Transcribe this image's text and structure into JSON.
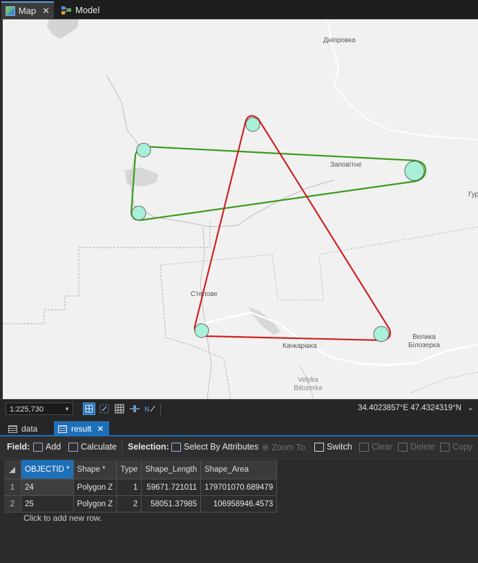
{
  "tabs": [
    {
      "label": "Map"
    },
    {
      "label": "Model"
    }
  ],
  "map": {
    "places": {
      "dniprovka": "Дніпровка",
      "zapovitne": "Заповітне",
      "hur": "Гур",
      "stepove": "Степове",
      "kachkarivka": "Качкарівка",
      "velyka_bilozerka_ua_1": "Велика",
      "velyka_bilozerka_ua_2": "Білозерка",
      "velyka_bilozerka_en_1": "Velyka",
      "velyka_bilozerka_en_2": "Bilozerka"
    },
    "colors": {
      "green_polygon": "#3a9a1a",
      "red_polygon": "#d01f1f",
      "vertex_fill": "#a8f0d8"
    }
  },
  "status": {
    "scale": "1:225,730",
    "coordinates": "34.4023857°E 47.4324319°N"
  },
  "table_tabs": [
    {
      "label": "data"
    },
    {
      "label": "result"
    }
  ],
  "toolbar": {
    "field_label": "Field:",
    "add": "Add",
    "calculate": "Calculate",
    "selection_label": "Selection:",
    "select_by_attributes": "Select By Attributes",
    "zoom_to": "Zoom To",
    "switch": "Switch",
    "clear": "Clear",
    "delete": "Delete",
    "copy": "Copy"
  },
  "table": {
    "columns": [
      "OBJECTID *",
      "Shape *",
      "Type",
      "Shape_Length",
      "Shape_Area"
    ],
    "rows": [
      {
        "row": "1",
        "objectid": "24",
        "shape": "Polygon Z",
        "type": "1",
        "length": "59671.721011",
        "area": "179701070.689479"
      },
      {
        "row": "2",
        "objectid": "25",
        "shape": "Polygon Z",
        "type": "2",
        "length": "58051.37985",
        "area": "106958946.4573"
      }
    ],
    "add_row": "Click to add new row."
  }
}
